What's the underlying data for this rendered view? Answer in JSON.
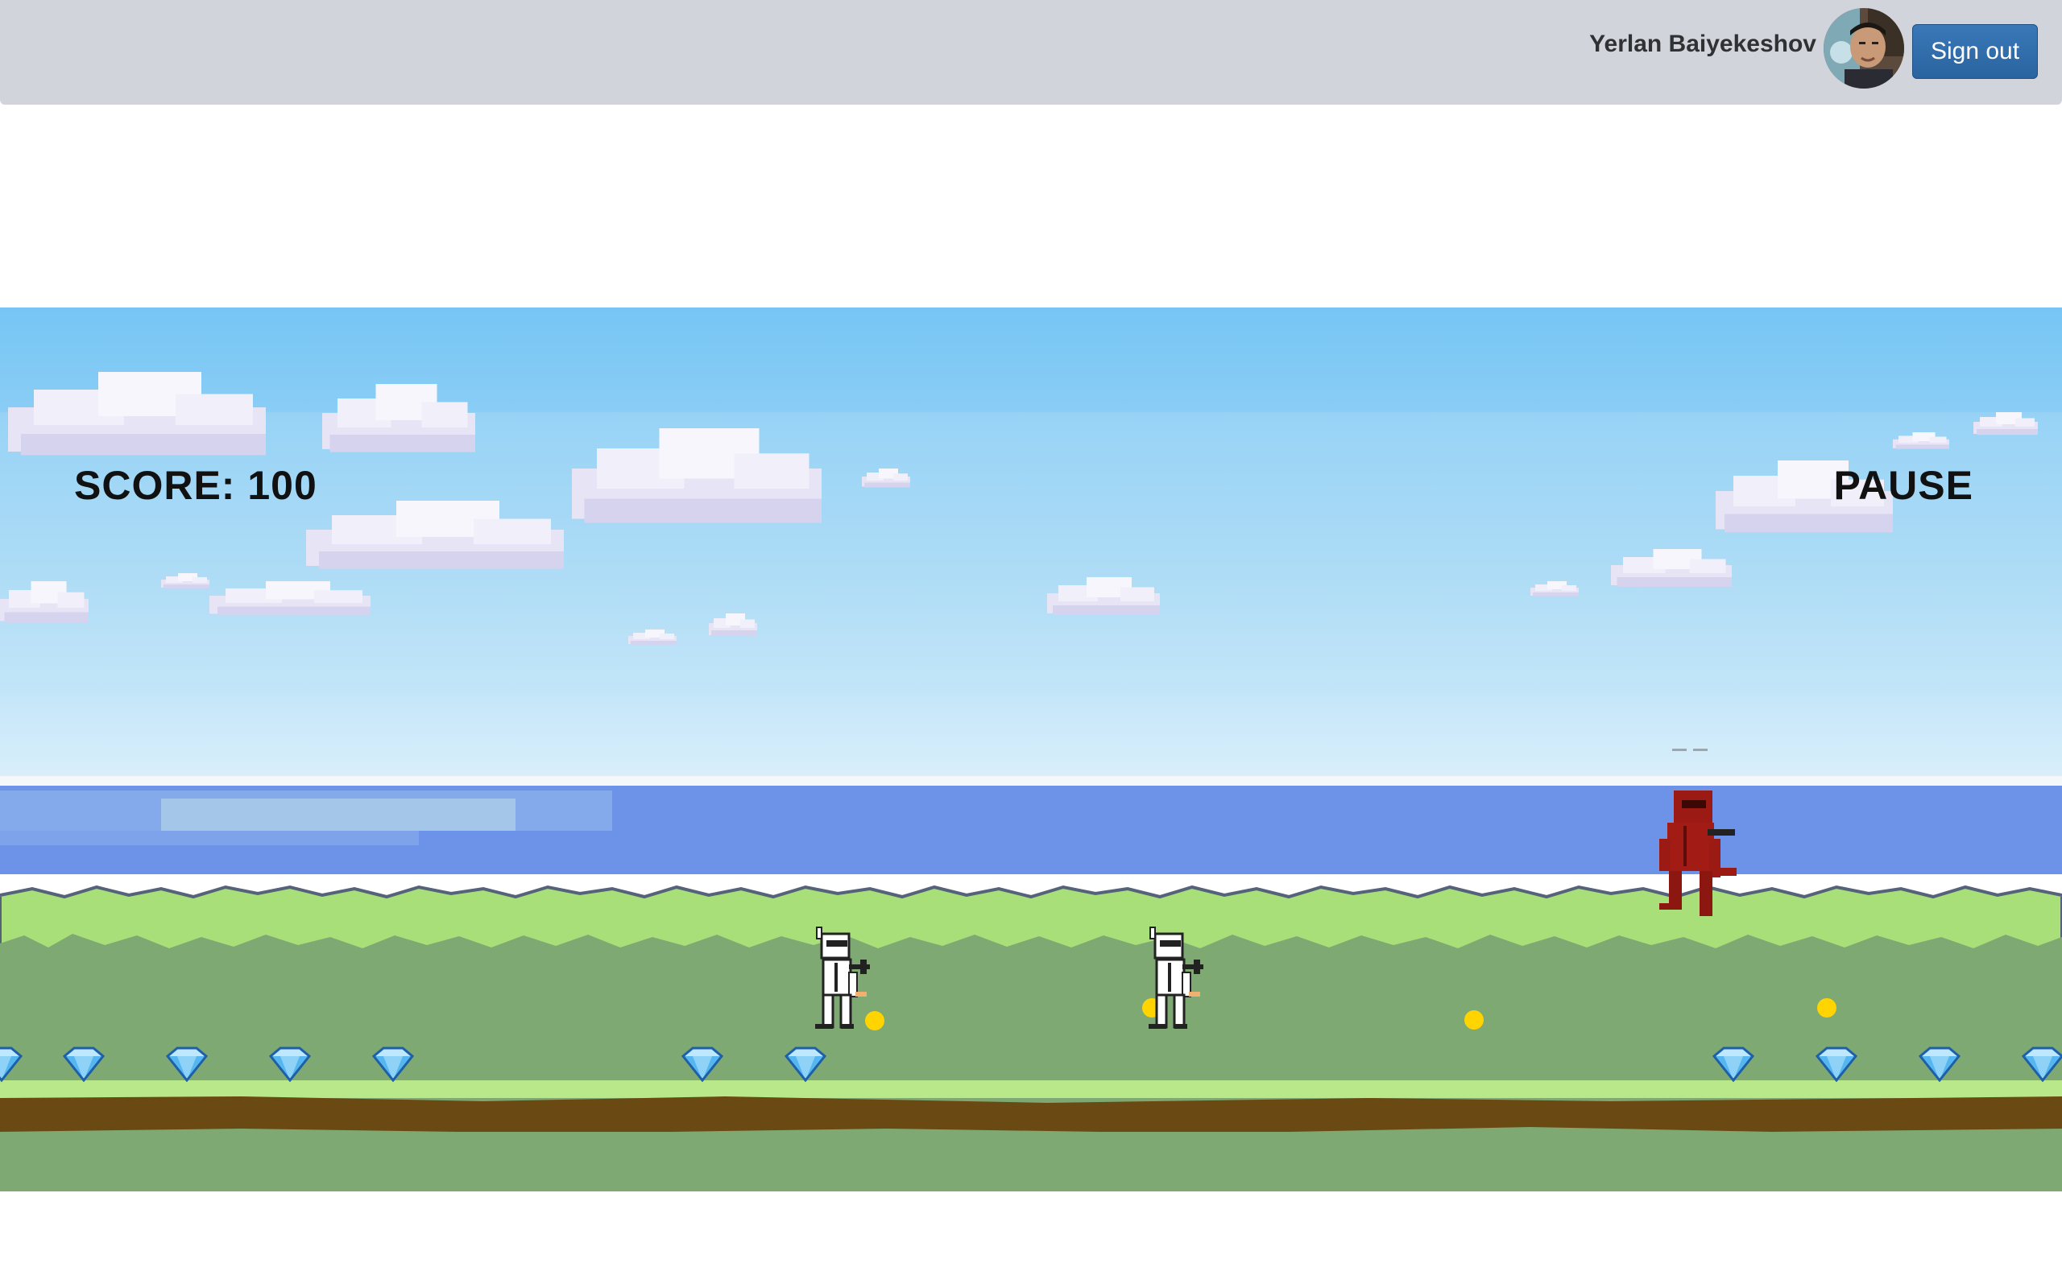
{
  "header": {
    "user_name": "Yerlan Baiyekeshov",
    "avatar": "user-avatar",
    "signout_label": "Sign out",
    "signout_color": "#2d6aa6"
  },
  "game": {
    "score_text": "SCORE: 100",
    "pause_label": "PAUSE",
    "colors": {
      "sky_top": "#7ac7f5",
      "sky_bottom": "#cde9f9",
      "sea": "#6d95e9",
      "grass_light": "#a8e07a",
      "grass": "#7faa71",
      "dirt": "#6a4a12"
    },
    "sprites": {
      "player": "white-ninja",
      "enemy": "red-ninja",
      "gem": "diamond",
      "coin": "gold-coin"
    }
  }
}
